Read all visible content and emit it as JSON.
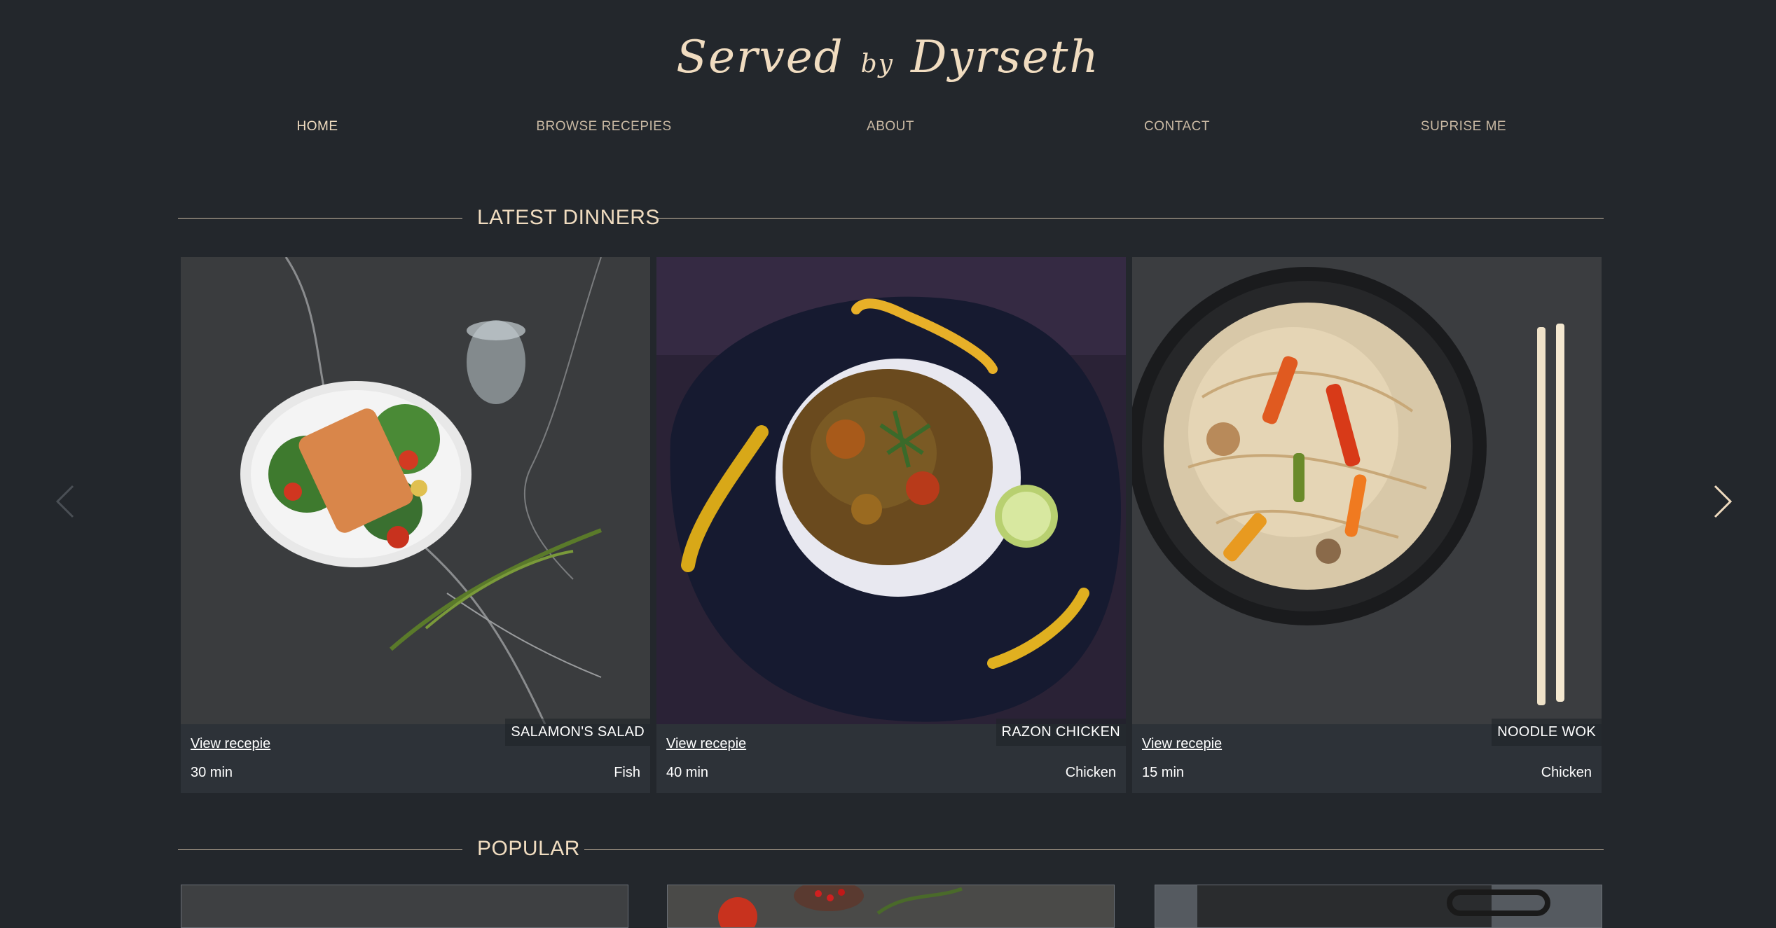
{
  "header": {
    "logo_main": "Served",
    "logo_by": "by",
    "logo_name": "Dyrseth"
  },
  "nav": {
    "home": "HOME",
    "browse": "BROWSE RECEPIES",
    "about": "ABOUT",
    "contact": "CONTACT",
    "surprise": "SUPRISE ME"
  },
  "latest": {
    "title": "LATEST DINNERS",
    "cards": [
      {
        "name": "SALAMON'S SALAD",
        "link": "View recepie",
        "time": "30 min",
        "category": "Fish"
      },
      {
        "name": "RAZON CHICKEN",
        "link": "View recepie",
        "time": "40 min",
        "category": "Chicken"
      },
      {
        "name": "NOODLE WOK",
        "link": "View recepie",
        "time": "15 min",
        "category": "Chicken"
      }
    ]
  },
  "popular": {
    "title": "POPULAR"
  },
  "colors": {
    "background": "#23272c",
    "accent": "#f0dcc0",
    "nav_text": "#c9b9a3",
    "card_bg": "#2d3238"
  }
}
